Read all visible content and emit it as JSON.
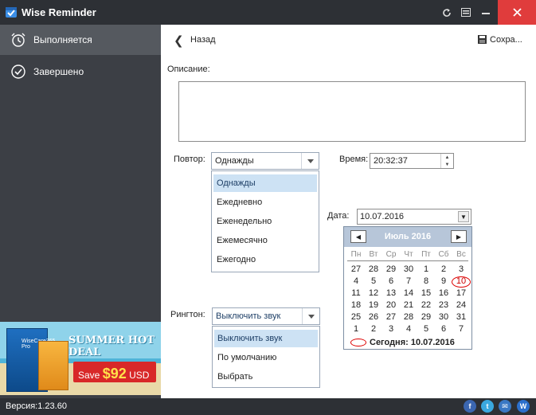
{
  "app": {
    "title": "Wise Reminder"
  },
  "sidebar": {
    "items": [
      {
        "label": "Выполняется",
        "icon": "alarm-clock-icon"
      },
      {
        "label": "Завершено",
        "icon": "check-circle-icon"
      }
    ]
  },
  "ad": {
    "headline": "SUMMER HOT DEAL",
    "save_prefix": "Save",
    "price": "$92",
    "currency": "USD",
    "product": "WiseCare365 Pro"
  },
  "footer": {
    "version": "Версия:1.23.60"
  },
  "toolbar": {
    "back_label": "Назад",
    "save_label": "Сохра..."
  },
  "form": {
    "description_label": "Описание:",
    "description_value": "",
    "repeat_label": "Повтор:",
    "repeat_value": "Однажды",
    "repeat_options": [
      "Однажды",
      "Ежедневно",
      "Еженедельно",
      "Ежемесячно",
      "Ежегодно"
    ],
    "time_label": "Время:",
    "time_value": "20:32:37",
    "date_label": "Дата:",
    "date_value": "10.07.2016",
    "ringtone_label": "Рингтон:",
    "ringtone_value": "Выключить звук",
    "ringtone_options": [
      "Выключить звук",
      "По умолчанию",
      "Выбрать"
    ]
  },
  "calendar": {
    "month_title": "Июль 2016",
    "weekdays": [
      "Пн",
      "Вт",
      "Ср",
      "Чт",
      "Пт",
      "Сб",
      "Вс"
    ],
    "weeks": [
      [
        "27",
        "28",
        "29",
        "30",
        "1",
        "2",
        "3"
      ],
      [
        "4",
        "5",
        "6",
        "7",
        "8",
        "9",
        "10"
      ],
      [
        "11",
        "12",
        "13",
        "14",
        "15",
        "16",
        "17"
      ],
      [
        "18",
        "19",
        "20",
        "21",
        "22",
        "23",
        "24"
      ],
      [
        "25",
        "26",
        "27",
        "28",
        "29",
        "30",
        "31"
      ],
      [
        "1",
        "2",
        "3",
        "4",
        "5",
        "6",
        "7"
      ]
    ],
    "today_text": "Сегодня: 10.07.2016",
    "selected_day": "10"
  },
  "colors": {
    "titlebar": "#2d3035",
    "sidebar": "#3c3f45",
    "sidebar_active": "#55595f",
    "close_button": "#e03c3c",
    "dropdown_highlight": "#cde2f4",
    "calendar_header": "#b7c6d9",
    "today_marker": "#dd0000"
  }
}
